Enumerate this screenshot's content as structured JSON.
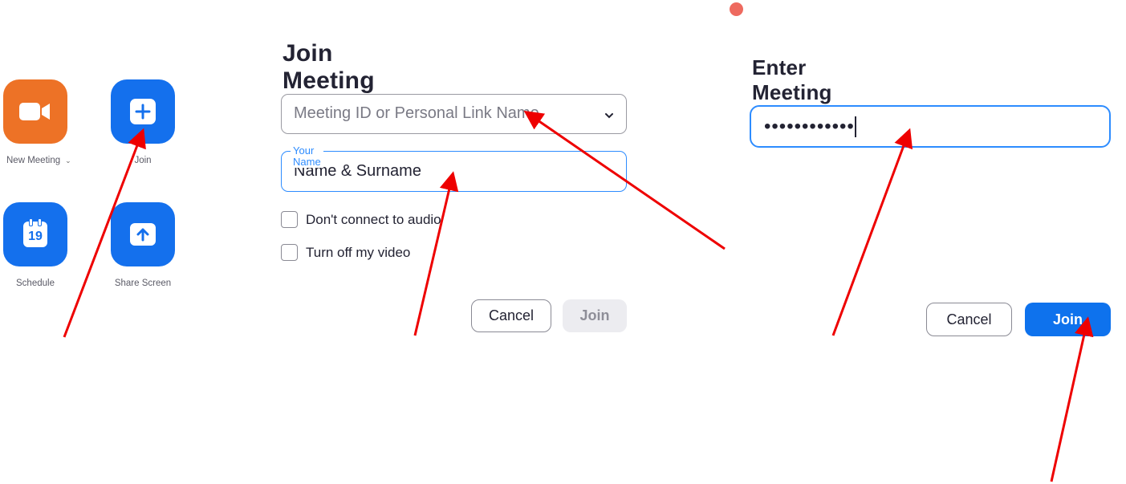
{
  "home": {
    "tiles": [
      {
        "label": "New Meeting",
        "icon": "video-camera-icon",
        "chevron": "⌄"
      },
      {
        "label": "Join",
        "icon": "plus-icon"
      },
      {
        "label": "Schedule",
        "icon": "calendar-icon",
        "calendar_day": "19"
      },
      {
        "label": "Share Screen",
        "icon": "share-arrow-icon"
      }
    ]
  },
  "join_dialog": {
    "title": "Join Meeting",
    "meeting_id_placeholder": "Meeting ID or Personal Link Name",
    "name_legend": "Your Name",
    "name_value": "Name & Surname",
    "options": [
      "Don't connect to audio",
      "Turn off my video"
    ],
    "cancel_label": "Cancel",
    "join_label": "Join"
  },
  "passcode_dialog": {
    "title": "Enter Meeting Passcode",
    "passcode_value": "••••••••••••",
    "cancel_label": "Cancel",
    "join_label": "Join"
  },
  "colors": {
    "orange_tile": "#ed7226",
    "blue_tile": "#1470ed",
    "focus_blue": "#2d8cff",
    "primary_button": "#0e72ed",
    "annotation_arrow": "#ee0000",
    "window_close_dot": "#ee6a5f"
  }
}
